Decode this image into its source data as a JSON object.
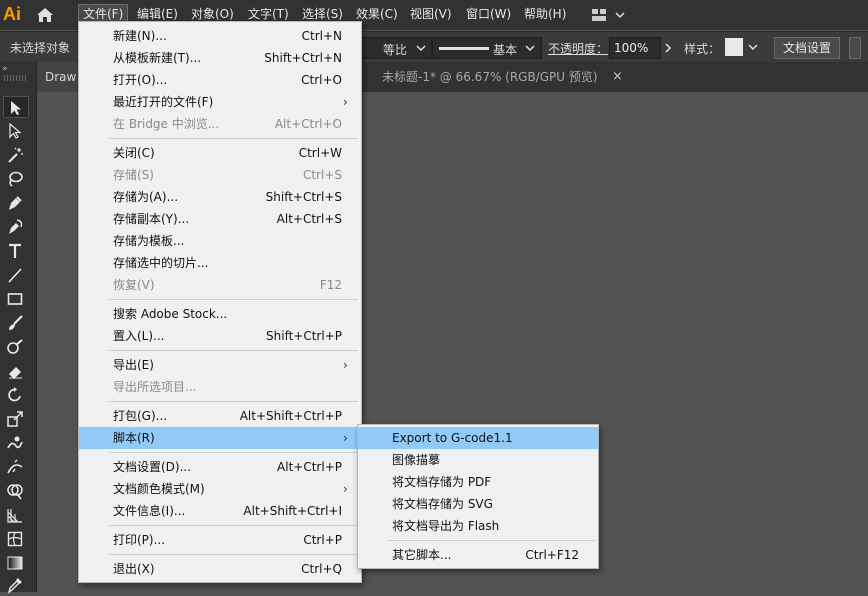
{
  "app": {
    "logo": "Ai"
  },
  "menubar": {
    "items": [
      "文件(F)",
      "编辑(E)",
      "对象(O)",
      "文字(T)",
      "选择(S)",
      "效果(C)",
      "视图(V)",
      "窗口(W)",
      "帮助(H)"
    ]
  },
  "controlbar": {
    "no_selection": "未选择对象",
    "stroke_profile": "等比",
    "brush": "基本",
    "opacity_label": "不透明度：",
    "opacity_value": "100%",
    "style_label": "样式：",
    "doc_setup_button": "文档设置"
  },
  "tabs": {
    "draw": "Draw",
    "untitled": "未标题-1* @ 66.67% (RGB/GPU 预览)",
    "close": "×"
  },
  "file_menu": {
    "items": [
      {
        "label": "新建(N)...",
        "shortcut": "Ctrl+N"
      },
      {
        "label": "从模板新建(T)...",
        "shortcut": "Shift+Ctrl+N"
      },
      {
        "label": "打开(O)...",
        "shortcut": "Ctrl+O"
      },
      {
        "label": "最近打开的文件(F)",
        "shortcut": ""
      },
      {
        "label": "在 Bridge 中浏览...",
        "shortcut": "Alt+Ctrl+O"
      },
      {
        "label": "关闭(C)",
        "shortcut": "Ctrl+W"
      },
      {
        "label": "存储(S)",
        "shortcut": "Ctrl+S"
      },
      {
        "label": "存储为(A)...",
        "shortcut": "Shift+Ctrl+S"
      },
      {
        "label": "存储副本(Y)...",
        "shortcut": "Alt+Ctrl+S"
      },
      {
        "label": "存储为模板...",
        "shortcut": ""
      },
      {
        "label": "存储选中的切片...",
        "shortcut": ""
      },
      {
        "label": "恢复(V)",
        "shortcut": "F12"
      },
      {
        "label": "搜索 Adobe Stock...",
        "shortcut": ""
      },
      {
        "label": "置入(L)...",
        "shortcut": "Shift+Ctrl+P"
      },
      {
        "label": "导出(E)",
        "shortcut": ""
      },
      {
        "label": "导出所选项目...",
        "shortcut": ""
      },
      {
        "label": "打包(G)...",
        "shortcut": "Alt+Shift+Ctrl+P"
      },
      {
        "label": "脚本(R)",
        "shortcut": ""
      },
      {
        "label": "文档设置(D)...",
        "shortcut": "Alt+Ctrl+P"
      },
      {
        "label": "文档颜色模式(M)",
        "shortcut": ""
      },
      {
        "label": "文件信息(I)...",
        "shortcut": "Alt+Shift+Ctrl+I"
      },
      {
        "label": "打印(P)...",
        "shortcut": "Ctrl+P"
      },
      {
        "label": "退出(X)",
        "shortcut": "Ctrl+Q"
      }
    ]
  },
  "script_menu": {
    "items": [
      {
        "label": "Export to G-code1.1",
        "shortcut": ""
      },
      {
        "label": "图像描摹",
        "shortcut": ""
      },
      {
        "label": "将文档存储为 PDF",
        "shortcut": ""
      },
      {
        "label": "将文档存储为 SVG",
        "shortcut": ""
      },
      {
        "label": "将文档导出为 Flash",
        "shortcut": ""
      },
      {
        "label": "其它脚本...",
        "shortcut": "Ctrl+F12"
      }
    ]
  },
  "colors": {
    "menu_highlight": "#91c9f7",
    "logo": "#ff9a00",
    "canvas_bg": "#535353"
  }
}
